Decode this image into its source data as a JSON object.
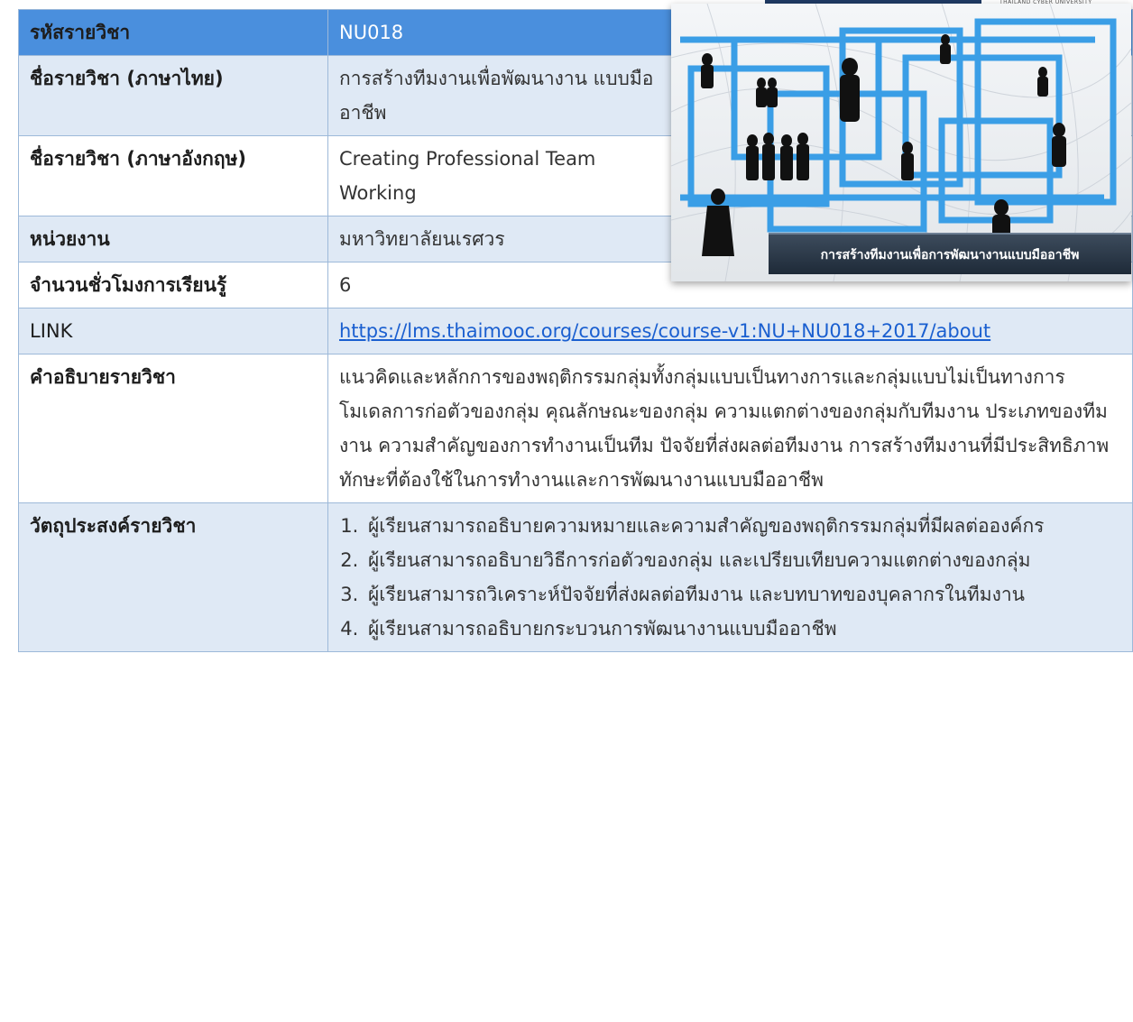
{
  "course": {
    "code_label": "รหัสรายวิชา",
    "code_value": "NU018",
    "name_th_label": "ชื่อรายวิชา (ภาษาไทย)",
    "name_th_value": "การสร้างทีมงานเพื่อพัฒนางาน แบบมืออาชีพ",
    "name_en_label": "ชื่อรายวิชา (ภาษาอังกฤษ)",
    "name_en_value": "Creating Professional Team Working",
    "unit_label": "หน่วยงาน",
    "unit_value": "มหาวิทยาลัยนเรศวร",
    "hours_label": "จำนวนชั่วโมงการเรียนรู้",
    "hours_value": "6",
    "link_label": "LINK",
    "link_value": "https://lms.thaimooc.org/courses/course-v1:NU+NU018+2017/about",
    "desc_label": "คำอธิบายรายวิชา",
    "desc_value": "แนวคิดและหลักการของพฤติกรรมกลุ่มทั้งกลุ่มแบบเป็นทางการและกลุ่มแบบไม่เป็นทางการ โมเดลการก่อตัวของกลุ่ม คุณลักษณะของกลุ่ม ความแตกต่างของกลุ่มกับทีมงาน ประเภทของทีมงาน ความสำคัญของการทำงานเป็นทีม ปัจจัยที่ส่งผลต่อทีมงาน การสร้างทีมงานที่มีประสิทธิภาพ ทักษะที่ต้องใช้ในการทำงานและการพัฒนางานแบบมืออาชีพ",
    "objectives_label": "วัตถุประสงค์รายวิชา",
    "objectives": [
      "ผู้เรียนสามารถอธิบายความหมายและความสำคัญของพฤติกรรมกลุ่มที่มีผลต่อองค์กร",
      "ผู้เรียนสามารถอธิบายวิธีการก่อตัวของกลุ่ม และเปรียบเทียบความแตกต่างของกลุ่ม",
      "ผู้เรียนสามารถวิเคราะห์ปัจจัยที่ส่งผลต่อทีมงาน และบทบาทของบุคลากรในทีมงาน",
      "ผู้เรียนสามารถอธิบายกระบวนการพัฒนางานแบบมืออาชีพ"
    ]
  },
  "cover": {
    "banner_text": "การสร้างทีมงานเพื่อการพัฒนางานแบบมืออาชีพ"
  },
  "header_logo_text": "THAILAND CYBER UNIVERSITY",
  "colors": {
    "header_bg": "#4a8fdd",
    "row_light": "#dfe9f5",
    "border": "#9db9d9",
    "link": "#1a5fd0"
  }
}
